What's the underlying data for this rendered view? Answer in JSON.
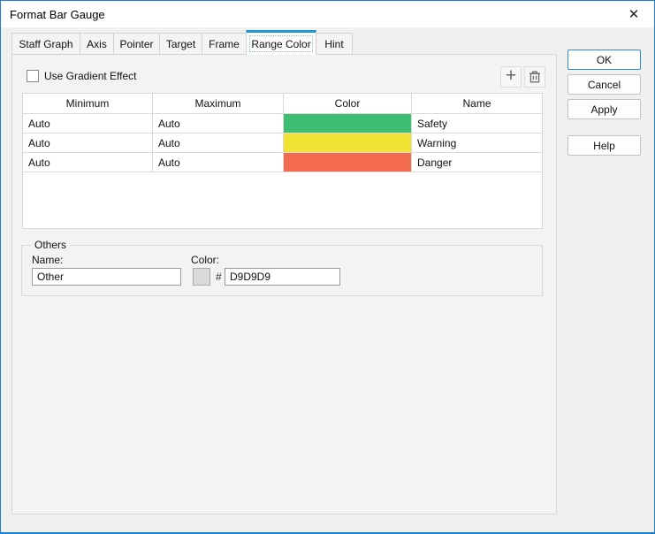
{
  "window": {
    "title": "Format Bar Gauge"
  },
  "icons": {
    "close_icon": "✕",
    "add_icon": "+",
    "delete_icon": "trash-can"
  },
  "tabs": [
    {
      "label": "Staff Graph",
      "active": false
    },
    {
      "label": "Axis",
      "active": false
    },
    {
      "label": "Pointer",
      "active": false
    },
    {
      "label": "Target",
      "active": false
    },
    {
      "label": "Frame",
      "active": false
    },
    {
      "label": "Range Color",
      "active": true
    },
    {
      "label": "Hint",
      "active": false
    }
  ],
  "panel": {
    "gradient_checkbox": {
      "label": "Use Gradient Effect",
      "checked": false
    },
    "table": {
      "columns": [
        "Minimum",
        "Maximum",
        "Color",
        "Name"
      ],
      "rows": [
        {
          "minimum": "Auto",
          "maximum": "Auto",
          "color": "#3EBE72",
          "name": "Safety"
        },
        {
          "minimum": "Auto",
          "maximum": "Auto",
          "color": "#F2E234",
          "name": "Warning"
        },
        {
          "minimum": "Auto",
          "maximum": "Auto",
          "color": "#F26A50",
          "name": "Danger"
        }
      ]
    },
    "others": {
      "legend": "Others",
      "name_label": "Name:",
      "name_value": "Other",
      "color_label": "Color:",
      "hash": "#",
      "color_value": "D9D9D9",
      "swatch_color": "#D9D9D9"
    }
  },
  "buttons": [
    {
      "label": "OK",
      "primary": true
    },
    {
      "label": "Cancel",
      "primary": false
    },
    {
      "label": "Apply",
      "primary": false
    },
    {
      "label": "Help",
      "primary": false
    }
  ],
  "colors": {
    "window_border": "#1E7FD1",
    "active_tab_accent": "#2196D9"
  }
}
